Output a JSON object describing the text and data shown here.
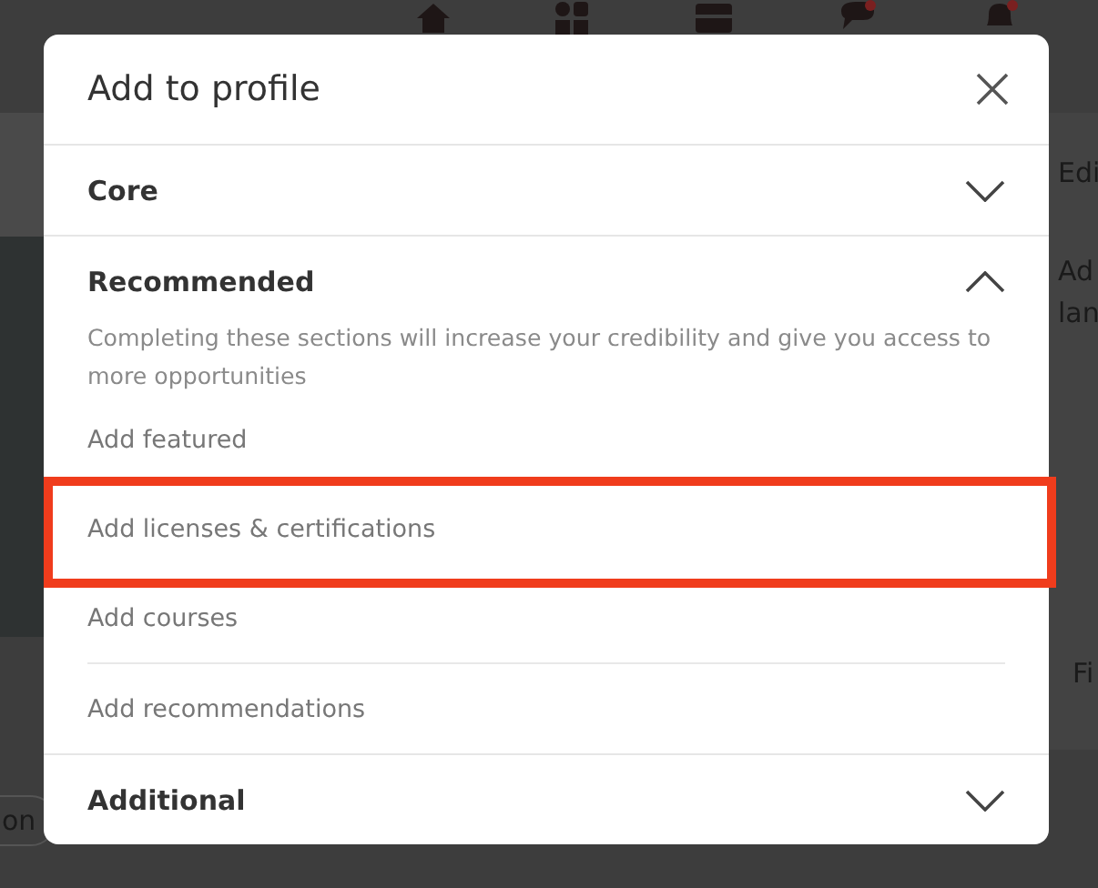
{
  "background": {
    "fragments": [
      {
        "text": "Edi",
        "kind": "right-top"
      },
      {
        "text": "Ad",
        "kind": "right-mid"
      },
      {
        "text": "lan",
        "kind": "right-mid2"
      },
      {
        "text": "Fi",
        "kind": "right-low"
      },
      {
        "text": "on",
        "kind": "left-pill"
      }
    ]
  },
  "modal": {
    "title": "Add to profile",
    "sections": [
      {
        "title": "Core",
        "expanded": false
      },
      {
        "title": "Recommended",
        "expanded": true,
        "description": "Completing these sections will increase your credibility and give you access to more opportunities",
        "items": [
          {
            "label": "Add featured",
            "highlighted": false
          },
          {
            "label": "Add licenses & certifications",
            "highlighted": true
          },
          {
            "label": "Add courses",
            "highlighted": false
          },
          {
            "label": "Add recommendations",
            "highlighted": false
          }
        ]
      },
      {
        "title": "Additional",
        "expanded": false
      }
    ]
  }
}
